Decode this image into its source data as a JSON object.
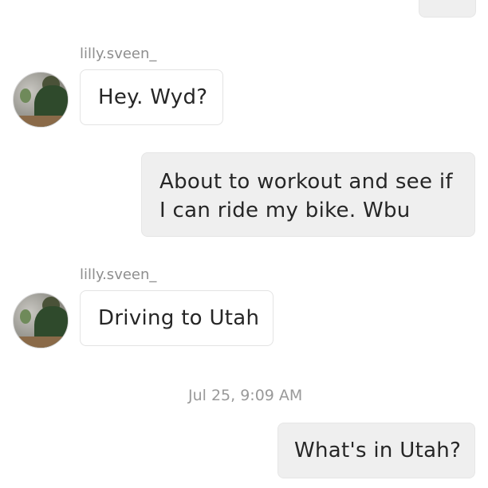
{
  "messages": [
    {
      "kind": "incoming",
      "sender": "lilly.sveen_",
      "text": "Hey. Wyd?"
    },
    {
      "kind": "outgoing",
      "text": "About to workout and see if\nI can ride my bike. Wbu"
    },
    {
      "kind": "incoming",
      "sender": "lilly.sveen_",
      "text": "Driving to Utah"
    },
    {
      "kind": "timestamp",
      "text": "Jul 25, 9:09 AM"
    },
    {
      "kind": "outgoing",
      "text": "What's in Utah?"
    }
  ]
}
